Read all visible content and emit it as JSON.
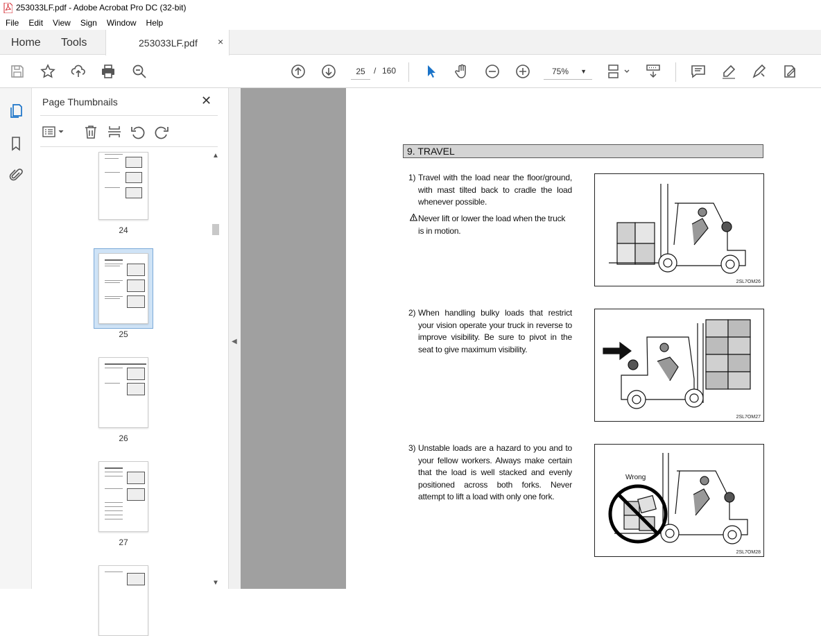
{
  "window": {
    "title": "253033LF.pdf - Adobe Acrobat Pro DC (32-bit)"
  },
  "menu": [
    "File",
    "Edit",
    "View",
    "Sign",
    "Window",
    "Help"
  ],
  "tabs": {
    "home": "Home",
    "tools": "Tools",
    "document": "253033LF.pdf",
    "close": "×"
  },
  "toolbar": {
    "current_page": "25",
    "separator": "/",
    "total_pages": "160",
    "zoom": "75%",
    "zoom_caret": "▼"
  },
  "thumbnails": {
    "title": "Page Thumbnails",
    "close": "✕",
    "pages": [
      {
        "label": "24"
      },
      {
        "label": "25",
        "selected": true
      },
      {
        "label": "26"
      },
      {
        "label": "27"
      }
    ]
  },
  "document": {
    "section_title": "9. TRAVEL",
    "items": [
      {
        "num": "1)",
        "text": "Travel with the load near the floor/ground, with mast tilted back to cradle the load whenever possible.",
        "figure_code": "2SL7OM26"
      },
      {
        "num": "2)",
        "text": "When handling bulky loads that restrict your vision operate your truck in reverse to improve visibility.  Be sure to pivot in the seat to give maximum visibility.",
        "figure_code": "2SL7OM27"
      },
      {
        "num": "3)",
        "text": "Unstable loads are a hazard to you and to your fellow workers.  Always make certain that the load is well stacked and evenly positioned across both forks.  Never attempt to lift a load with only one fork.",
        "figure_code": "2SL7OM28"
      }
    ],
    "warning": "Never lift or lower the load when the truck is in motion.",
    "wrong_label": "Wrong"
  },
  "colors": {
    "accent": "#1a73c8",
    "viewer_bg": "#a0a0a0",
    "tab_bg": "#f2f2f2"
  }
}
